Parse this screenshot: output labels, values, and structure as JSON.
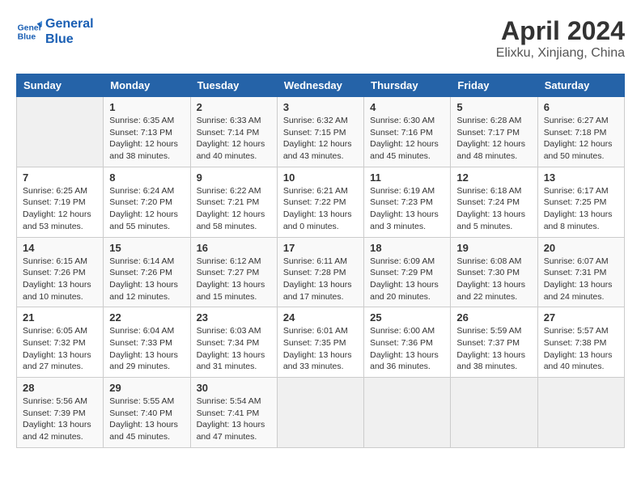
{
  "header": {
    "logo_line1": "General",
    "logo_line2": "Blue",
    "month_title": "April 2024",
    "location": "Elixku, Xinjiang, China"
  },
  "days_of_week": [
    "Sunday",
    "Monday",
    "Tuesday",
    "Wednesday",
    "Thursday",
    "Friday",
    "Saturday"
  ],
  "weeks": [
    [
      {
        "day": "",
        "info": ""
      },
      {
        "day": "1",
        "info": "Sunrise: 6:35 AM\nSunset: 7:13 PM\nDaylight: 12 hours\nand 38 minutes."
      },
      {
        "day": "2",
        "info": "Sunrise: 6:33 AM\nSunset: 7:14 PM\nDaylight: 12 hours\nand 40 minutes."
      },
      {
        "day": "3",
        "info": "Sunrise: 6:32 AM\nSunset: 7:15 PM\nDaylight: 12 hours\nand 43 minutes."
      },
      {
        "day": "4",
        "info": "Sunrise: 6:30 AM\nSunset: 7:16 PM\nDaylight: 12 hours\nand 45 minutes."
      },
      {
        "day": "5",
        "info": "Sunrise: 6:28 AM\nSunset: 7:17 PM\nDaylight: 12 hours\nand 48 minutes."
      },
      {
        "day": "6",
        "info": "Sunrise: 6:27 AM\nSunset: 7:18 PM\nDaylight: 12 hours\nand 50 minutes."
      }
    ],
    [
      {
        "day": "7",
        "info": "Sunrise: 6:25 AM\nSunset: 7:19 PM\nDaylight: 12 hours\nand 53 minutes."
      },
      {
        "day": "8",
        "info": "Sunrise: 6:24 AM\nSunset: 7:20 PM\nDaylight: 12 hours\nand 55 minutes."
      },
      {
        "day": "9",
        "info": "Sunrise: 6:22 AM\nSunset: 7:21 PM\nDaylight: 12 hours\nand 58 minutes."
      },
      {
        "day": "10",
        "info": "Sunrise: 6:21 AM\nSunset: 7:22 PM\nDaylight: 13 hours\nand 0 minutes."
      },
      {
        "day": "11",
        "info": "Sunrise: 6:19 AM\nSunset: 7:23 PM\nDaylight: 13 hours\nand 3 minutes."
      },
      {
        "day": "12",
        "info": "Sunrise: 6:18 AM\nSunset: 7:24 PM\nDaylight: 13 hours\nand 5 minutes."
      },
      {
        "day": "13",
        "info": "Sunrise: 6:17 AM\nSunset: 7:25 PM\nDaylight: 13 hours\nand 8 minutes."
      }
    ],
    [
      {
        "day": "14",
        "info": "Sunrise: 6:15 AM\nSunset: 7:26 PM\nDaylight: 13 hours\nand 10 minutes."
      },
      {
        "day": "15",
        "info": "Sunrise: 6:14 AM\nSunset: 7:26 PM\nDaylight: 13 hours\nand 12 minutes."
      },
      {
        "day": "16",
        "info": "Sunrise: 6:12 AM\nSunset: 7:27 PM\nDaylight: 13 hours\nand 15 minutes."
      },
      {
        "day": "17",
        "info": "Sunrise: 6:11 AM\nSunset: 7:28 PM\nDaylight: 13 hours\nand 17 minutes."
      },
      {
        "day": "18",
        "info": "Sunrise: 6:09 AM\nSunset: 7:29 PM\nDaylight: 13 hours\nand 20 minutes."
      },
      {
        "day": "19",
        "info": "Sunrise: 6:08 AM\nSunset: 7:30 PM\nDaylight: 13 hours\nand 22 minutes."
      },
      {
        "day": "20",
        "info": "Sunrise: 6:07 AM\nSunset: 7:31 PM\nDaylight: 13 hours\nand 24 minutes."
      }
    ],
    [
      {
        "day": "21",
        "info": "Sunrise: 6:05 AM\nSunset: 7:32 PM\nDaylight: 13 hours\nand 27 minutes."
      },
      {
        "day": "22",
        "info": "Sunrise: 6:04 AM\nSunset: 7:33 PM\nDaylight: 13 hours\nand 29 minutes."
      },
      {
        "day": "23",
        "info": "Sunrise: 6:03 AM\nSunset: 7:34 PM\nDaylight: 13 hours\nand 31 minutes."
      },
      {
        "day": "24",
        "info": "Sunrise: 6:01 AM\nSunset: 7:35 PM\nDaylight: 13 hours\nand 33 minutes."
      },
      {
        "day": "25",
        "info": "Sunrise: 6:00 AM\nSunset: 7:36 PM\nDaylight: 13 hours\nand 36 minutes."
      },
      {
        "day": "26",
        "info": "Sunrise: 5:59 AM\nSunset: 7:37 PM\nDaylight: 13 hours\nand 38 minutes."
      },
      {
        "day": "27",
        "info": "Sunrise: 5:57 AM\nSunset: 7:38 PM\nDaylight: 13 hours\nand 40 minutes."
      }
    ],
    [
      {
        "day": "28",
        "info": "Sunrise: 5:56 AM\nSunset: 7:39 PM\nDaylight: 13 hours\nand 42 minutes."
      },
      {
        "day": "29",
        "info": "Sunrise: 5:55 AM\nSunset: 7:40 PM\nDaylight: 13 hours\nand 45 minutes."
      },
      {
        "day": "30",
        "info": "Sunrise: 5:54 AM\nSunset: 7:41 PM\nDaylight: 13 hours\nand 47 minutes."
      },
      {
        "day": "",
        "info": ""
      },
      {
        "day": "",
        "info": ""
      },
      {
        "day": "",
        "info": ""
      },
      {
        "day": "",
        "info": ""
      }
    ]
  ]
}
